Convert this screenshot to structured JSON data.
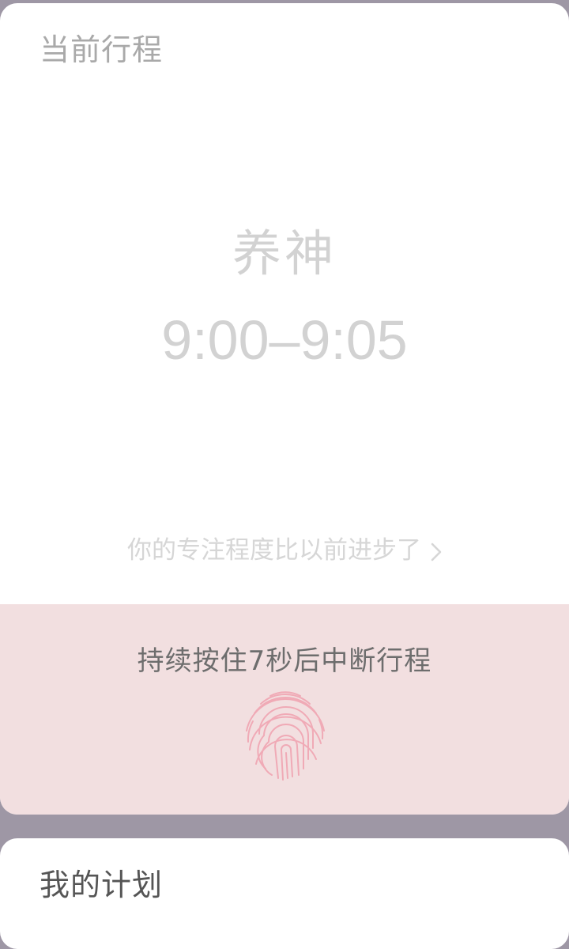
{
  "current_trip": {
    "section_title": "当前行程",
    "task_name": "养神",
    "time_range": "9:00–9:05",
    "progress_link": "你的专注程度比以前进步了",
    "hold_hint": "持续按住7秒后中断行程"
  },
  "plan": {
    "section_title": "我的计划"
  },
  "icons": {
    "chevron": "chevron-right-icon",
    "fingerprint": "fingerprint-icon"
  },
  "colors": {
    "backdrop": "#9e97a5",
    "panel": "#f2dfe0",
    "fingerprint": "#f0aab6"
  }
}
